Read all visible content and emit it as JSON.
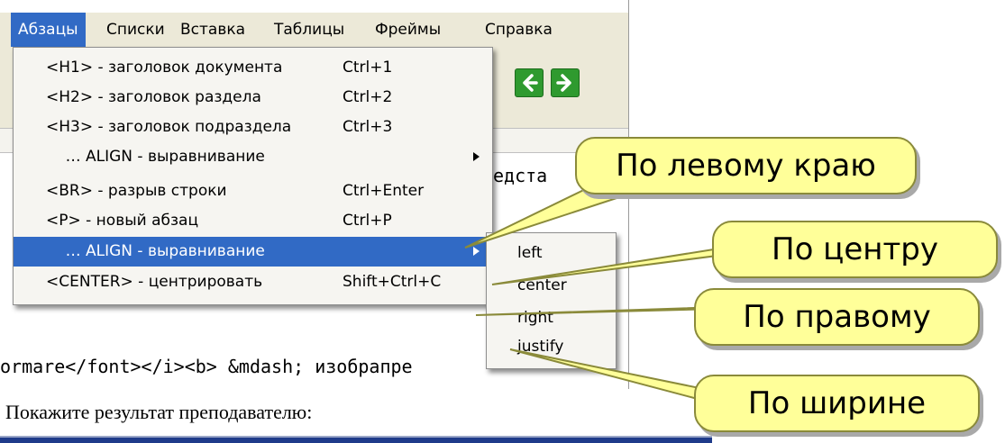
{
  "menubar": {
    "items": [
      "Абзацы",
      "Списки",
      "Вставка",
      "Таблицы",
      "Фреймы",
      "Справка"
    ]
  },
  "dropdown": {
    "items": [
      {
        "label": "<H1> - заголовок документа",
        "shortcut": "Ctrl+1"
      },
      {
        "label": "<H2> - заголовок раздела",
        "shortcut": "Ctrl+2"
      },
      {
        "label": "<H3> - заголовок подраздела",
        "shortcut": "Ctrl+3"
      },
      {
        "label": "    … ALIGN - выравнивание",
        "shortcut": ""
      },
      {
        "label": "<BR> - разрыв строки",
        "shortcut": "Ctrl+Enter"
      },
      {
        "label": "<P> - новый абзац",
        "shortcut": "Ctrl+P"
      },
      {
        "label": "    … ALIGN - выравнивание",
        "shortcut": ""
      },
      {
        "label": "<CENTER> - центрировать",
        "shortcut": "Shift+Ctrl+C"
      }
    ],
    "highlighted_index": 6
  },
  "submenu": {
    "items": [
      "left",
      "center",
      "right",
      "justify"
    ]
  },
  "code": {
    "fragment_right": "едста",
    "line_bottom": "ormare</font></i><b> &mdash; изобра",
    "line_bottom_tail": "пре"
  },
  "callouts": {
    "left": "По левому краю",
    "center": "По центру",
    "right": "По правому",
    "justify": "По ширине"
  },
  "caption": "Покажите результат преподавателю:",
  "colors": {
    "menu_highlight": "#316ac5",
    "callout_fill": "#ffff99",
    "arrow_green": "#2f9a2f"
  }
}
